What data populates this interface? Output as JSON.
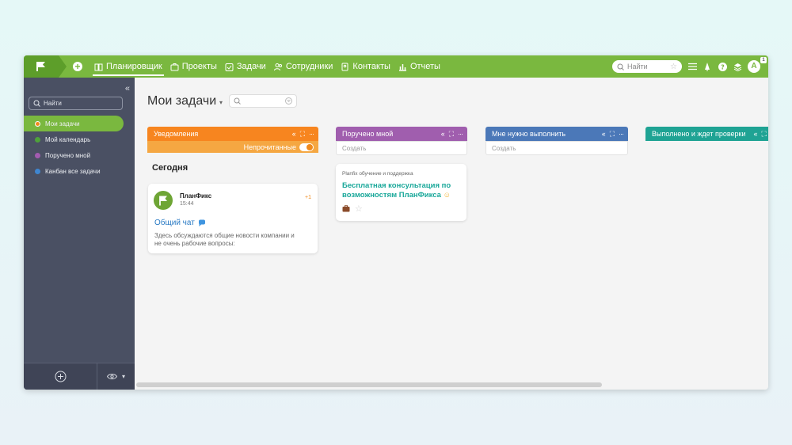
{
  "topbar": {
    "nav": [
      {
        "label": "Планировщик",
        "icon": "book-icon",
        "active": true
      },
      {
        "label": "Проекты",
        "icon": "briefcase-icon"
      },
      {
        "label": "Задачи",
        "icon": "task-check-icon"
      },
      {
        "label": "Сотрудники",
        "icon": "people-icon"
      },
      {
        "label": "Контакты",
        "icon": "contacts-icon"
      },
      {
        "label": "Отчеты",
        "icon": "chart-icon"
      }
    ],
    "search_placeholder": "Найти",
    "avatar_letter": "A",
    "avatar_badge": "1",
    "accent": "#7ab83f"
  },
  "sidebar": {
    "search_placeholder": "Найти",
    "items": [
      {
        "label": "Мои задачи",
        "color": "#f08a1d",
        "active": true
      },
      {
        "label": "Мой календарь",
        "color": "#4ea13a"
      },
      {
        "label": "Поручено мной",
        "color": "#a25bb0"
      },
      {
        "label": "Канбан все задачи",
        "color": "#3f86d0"
      }
    ]
  },
  "main": {
    "title": "Мои задачи",
    "section_today": "Сегодня",
    "columns": [
      {
        "title": "Уведомления",
        "color": "#f7851f",
        "sub_label": "Непрочитанные"
      },
      {
        "title": "Поручено мной",
        "color": "#a05eae",
        "create": "Создать"
      },
      {
        "title": "Мне нужно выполнить",
        "color": "#4b78b8",
        "create": "Создать"
      },
      {
        "title": "Выполнено и ждет проверки",
        "color": "#1fa394"
      }
    ],
    "chat_card": {
      "name": "ПланФикс",
      "time": "15:44",
      "count": "+1",
      "title": "Общий чат",
      "text": "Здесь обсуждаются общие новости компании и не очень рабочие вопросы:"
    },
    "task_card": {
      "project": "Planfix обучение и поддержка",
      "title": "Бесплатная консультация по возможностям ПланФикса"
    }
  }
}
